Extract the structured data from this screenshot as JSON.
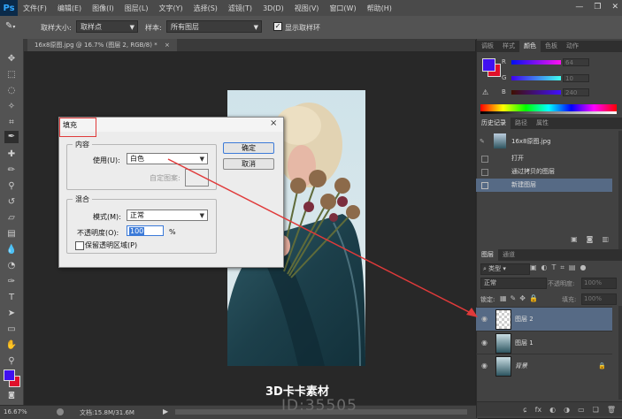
{
  "app": {
    "logo": "Ps"
  },
  "menu": {
    "items": [
      "文件(F)",
      "编辑(E)",
      "图像(I)",
      "图层(L)",
      "文字(Y)",
      "选择(S)",
      "滤镜(T)",
      "3D(D)",
      "视图(V)",
      "窗口(W)",
      "帮助(H)"
    ],
    "controls": [
      "—",
      "❐",
      "✕"
    ]
  },
  "options": {
    "sample_size_label": "取样大小:",
    "sample_size_value": "取样点",
    "sample_label": "样本:",
    "sample_value": "所有图层",
    "show_ring_label": "显示取样环",
    "show_ring_checked": true
  },
  "document": {
    "tab_title": "16x8原图.jpg @ 16.7% (图层 2, RGB/8) *",
    "close": "×"
  },
  "status": {
    "zoom": "16.67%",
    "doc_size": "文档:15.8M/31.6M"
  },
  "panels": {
    "top_tabs": [
      "调板",
      "样式",
      "颜色",
      "色板",
      "动作"
    ],
    "active_top_tab": "颜色",
    "color": {
      "channels": [
        {
          "label": "R",
          "value": "64"
        },
        {
          "label": "G",
          "value": "10"
        },
        {
          "label": "B",
          "value": "240"
        }
      ],
      "foreground": "#4010f0",
      "background": "#e0102a"
    },
    "history_tabs": [
      "历史记录",
      "路径",
      "属性"
    ],
    "history": {
      "snapshot": "16x8原图.jpg",
      "steps": [
        "打开",
        "通过拷贝的图层",
        "新建图层"
      ]
    },
    "layers_tabs": [
      "图层",
      "通道"
    ],
    "layers": {
      "kind_label": "类型",
      "blend_mode": "正常",
      "opacity_label": "不透明度:",
      "opacity_value": "100%",
      "lock_label": "锁定:",
      "fill_label": "填充:",
      "fill_value": "100%",
      "rows": [
        {
          "name": "图层 2",
          "selected": true
        },
        {
          "name": "图层 1",
          "selected": false
        },
        {
          "name": "背景",
          "selected": false
        }
      ],
      "footer_icons": [
        "ɕ",
        "fx",
        "◐",
        "◑",
        "▭",
        "❏",
        "🗑"
      ]
    }
  },
  "dialog": {
    "title": "填充",
    "close": "×",
    "content_group": "内容",
    "use_label": "使用(U):",
    "use_value": "白色",
    "custom_pattern_label": "自定图案:",
    "blend_group": "混合",
    "mode_label": "模式(M):",
    "mode_value": "正常",
    "opacity_label": "不透明度(O):",
    "opacity_value": "100",
    "opacity_unit": "%",
    "preserve_label": "保留透明区域(P)",
    "ok": "确定",
    "cancel": "取消"
  },
  "watermarks": {
    "brand": "3D卡卡素材",
    "id": "ID:35505"
  },
  "colors": {
    "accent_red": "#e03a3a",
    "selection_blue": "#566a85"
  }
}
